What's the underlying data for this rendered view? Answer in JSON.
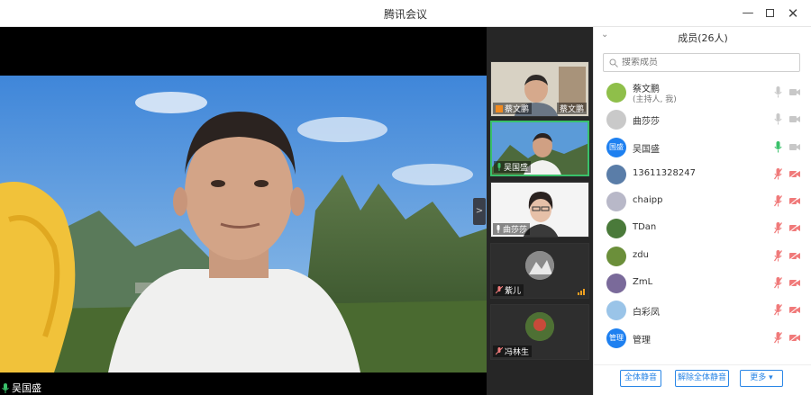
{
  "window": {
    "title": "腾讯会议",
    "minimize": "—",
    "close": "✕"
  },
  "main_video": {
    "speaker_name": "吴国盛"
  },
  "thumbnails": [
    {
      "name": "蔡文鹏",
      "extra": "蔡文鹏"
    },
    {
      "name": "吴国盛"
    },
    {
      "name": "曲莎莎"
    },
    {
      "name": "紫儿"
    },
    {
      "name": "冯林生"
    }
  ],
  "panel": {
    "collapse_icon": "⌄",
    "title": "成员(26人)",
    "search_placeholder": "搜索成员",
    "members": [
      {
        "name": "蔡文鹏",
        "sub": "(主持人, 我)",
        "avatar_color": "#8fbf4a",
        "avatar_text": "",
        "mic": "off-grey",
        "cam": "grey"
      },
      {
        "name": "曲莎莎",
        "avatar_color": "#c9c9c9",
        "avatar_text": "",
        "mic": "off-grey",
        "cam": "grey"
      },
      {
        "name": "吴国盛",
        "avatar_color": "#1e80f0",
        "avatar_text": "国盛",
        "mic": "on-green",
        "cam": "grey"
      },
      {
        "name": "13611328247",
        "avatar_color": "#5a7da8",
        "avatar_text": "",
        "mic": "muted-red",
        "cam": "red"
      },
      {
        "name": "chaipp",
        "avatar_color": "#b8b8c8",
        "avatar_text": "",
        "mic": "muted-red",
        "cam": "red"
      },
      {
        "name": "TDan",
        "avatar_color": "#4a7a3a",
        "avatar_text": "",
        "mic": "muted-red",
        "cam": "red"
      },
      {
        "name": "zdu",
        "avatar_color": "#6b8f3a",
        "avatar_text": "",
        "mic": "muted-red",
        "cam": "red"
      },
      {
        "name": "ZmL",
        "avatar_color": "#7a6a9a",
        "avatar_text": "",
        "mic": "muted-red",
        "cam": "red"
      },
      {
        "name": "白彩凤",
        "avatar_color": "#9ac4e8",
        "avatar_text": "",
        "mic": "muted-red",
        "cam": "red"
      },
      {
        "name": "管理",
        "avatar_color": "#1e80f0",
        "avatar_text": "管理",
        "mic": "muted-red",
        "cam": "red"
      }
    ],
    "buttons": {
      "mute_all": "全体静音",
      "unmute_all": "解除全体静音",
      "more": "更多 ▾"
    }
  },
  "colors": {
    "accent_blue": "#2a86e6",
    "active_green": "#39c16a",
    "muted_red": "#f07a7a"
  }
}
